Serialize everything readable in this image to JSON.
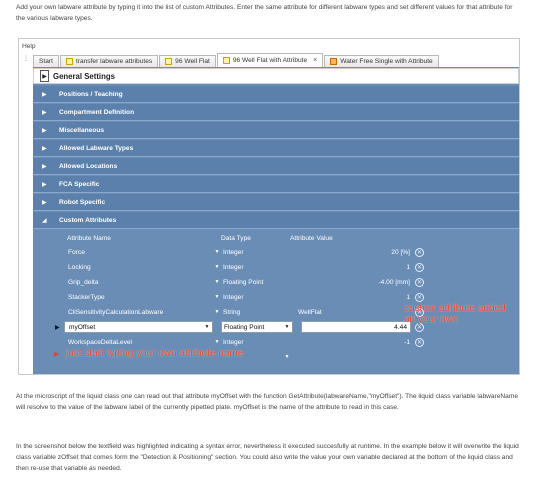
{
  "article": {
    "intro": "Add your own labware attribute by typing it into the list of custom Attributes. Enter the same attribute for different labware types and set different values for that attribute for the various labware types.",
    "para1": "At the microscript of the liquid class one can read out that attribute myOffset with the function GetAttribute(labwareName,\"myOffset\"). The liquid class variable labwareName will resolve to the value of the labware label of the currently pipetted plate. myOffset is the name of the attribute to read in this case.",
    "para2": "In the screenshot below the textfield was highlighted indicating a syntax error, nevertheless it executed succesfully at runtime. In the example below it will overwrite the liquid class variable zOffset that comes form the \"Detection & Positioning\" section. You could also write the value your own variable declared at the bottom of the liquid class and then re-use that variable as needed."
  },
  "app": {
    "menu": "Help",
    "tabs": [
      {
        "label": "Start"
      },
      {
        "label": "transfer labware attributes",
        "icon": "plate-icon"
      },
      {
        "label": "96 Well Flat",
        "icon": "plate-icon"
      },
      {
        "label": "96 Well Flat with Attribute",
        "icon": "plate-icon",
        "active": true,
        "close": "×"
      },
      {
        "label": "Water Free Single with Attribute",
        "icon": "liquid-icon"
      }
    ],
    "general_settings": "General Settings",
    "sections": [
      "Positions / Teaching",
      "Compartment Definition",
      "Miscellaneous",
      "Allowed Labware Types",
      "Allowed Locations",
      "FCA Specific",
      "Robot Specific",
      "Custom Attributes"
    ],
    "columns": {
      "name": "Attribute Name",
      "type": "Data Type",
      "value": "Attribute Value"
    },
    "attributes": [
      {
        "name": "Force",
        "type": "Integer",
        "value": "20  [%]"
      },
      {
        "name": "Locking",
        "type": "Integer",
        "value": "1"
      },
      {
        "name": "Grip_delta",
        "type": "Floating Point",
        "value": "-4.00  [mm]"
      },
      {
        "name": "StackerType",
        "type": "Integer",
        "value": "1"
      },
      {
        "name": "CliSensitivityCalculationLabware",
        "type": "String",
        "value": "WellFlat"
      },
      {
        "name": "myOffset",
        "type": "Floating Point",
        "value": "4.44"
      },
      {
        "name": "WorkspaceDeltaLevel",
        "type": "Integer",
        "value": "-1"
      }
    ],
    "annotations": {
      "custom": "custom attribute added on your own",
      "start": "just start typing your own attribute name"
    }
  },
  "colors": {
    "panel": "#6a8db6",
    "section": "#5b80ab",
    "annotation": "#e0402a"
  }
}
